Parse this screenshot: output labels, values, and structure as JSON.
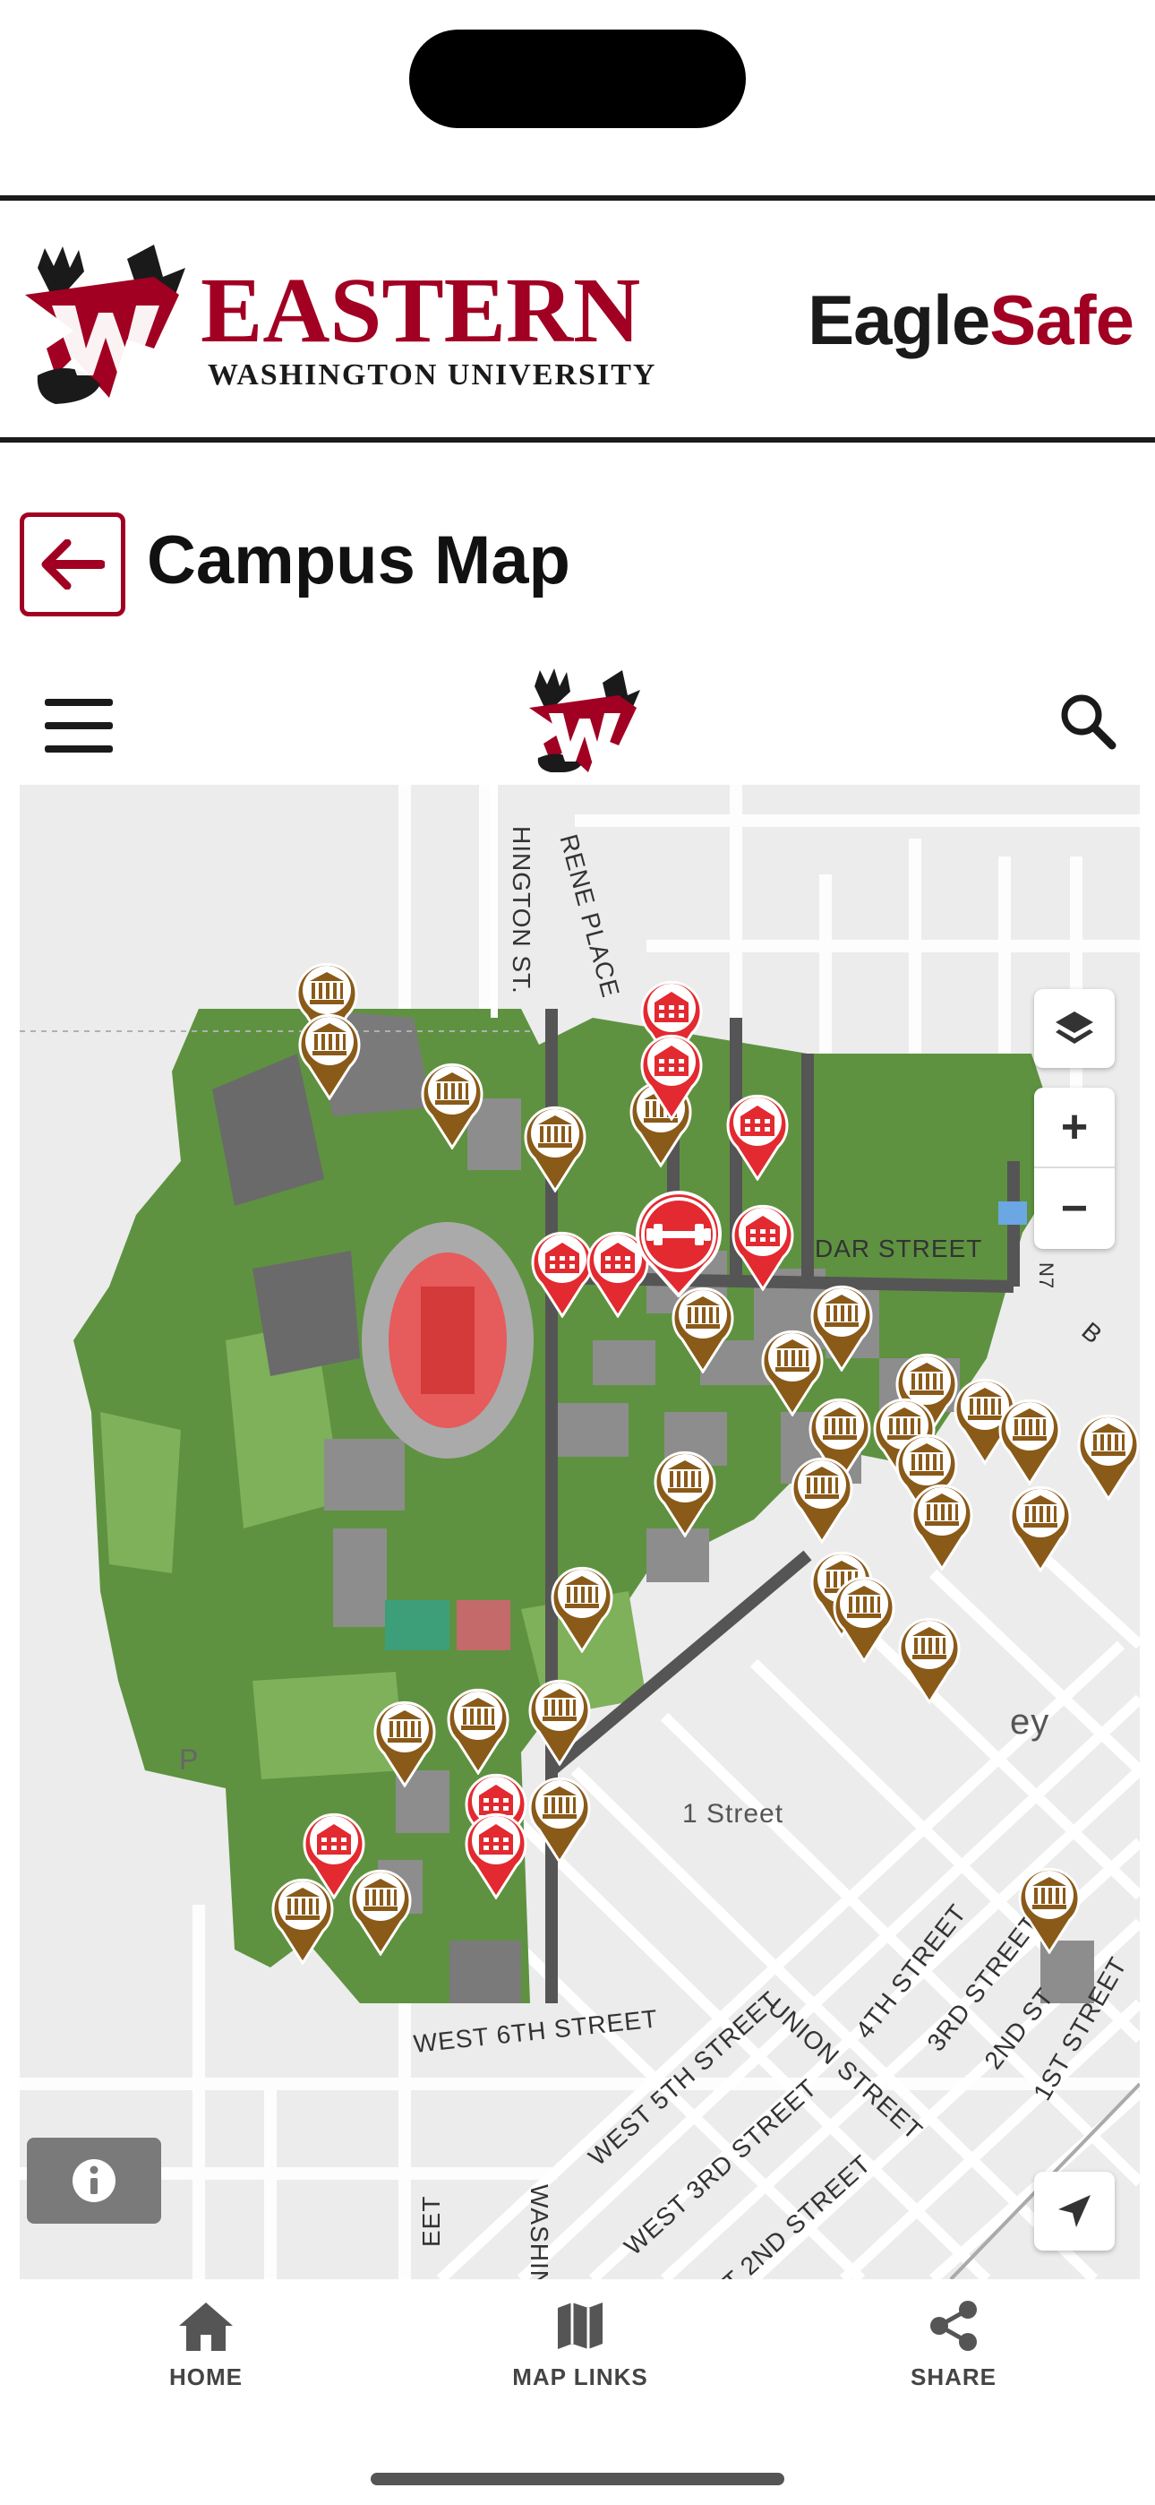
{
  "brand": {
    "logo_primary": "EASTERN",
    "logo_secondary": "WASHINGTON UNIVERSITY",
    "app_name_part1": "Eagle",
    "app_name_part2": "Safe",
    "colors": {
      "crimson": "#a10022",
      "pin_red": "#e22a30",
      "pin_brown": "#8a5a19"
    }
  },
  "page": {
    "title": "Campus Map",
    "back_icon": "arrow-left-icon"
  },
  "toolbar": {
    "menu_icon": "hamburger-menu-icon",
    "logo_icon": "eagle-logo-icon",
    "search_icon": "search-icon"
  },
  "map": {
    "controls": {
      "zoom_in": "+",
      "zoom_out": "−",
      "layers_icon": "layers-icon",
      "info_icon": "info-icon",
      "locate_icon": "location-arrow-icon"
    },
    "streets": {
      "washington_top": "HINGTON ST.",
      "irene": "RENE PLACE",
      "cedar": "DAR STREET",
      "sixth": "WEST 6TH STREET",
      "fifth": "WEST 5TH STREET",
      "third": "WEST 3RD STREET",
      "second": "T 2ND STREET",
      "union": "UNION STREET",
      "fourth": "4TH STREET",
      "third_e": "3RD STREET",
      "second_e": "2ND ST",
      "first_e": "1ST STREET",
      "first_st": "1 Street",
      "washing_bottom": "WASHING",
      "eet_bottom": "EET",
      "cheney": "ey",
      "p_label": "P",
      "b_label": "B",
      "n7": "N7"
    }
  },
  "nav": {
    "items": [
      {
        "label": "HOME",
        "icon": "home-icon"
      },
      {
        "label": "MAP LINKS",
        "icon": "map-icon"
      },
      {
        "label": "SHARE",
        "icon": "share-icon"
      }
    ]
  }
}
